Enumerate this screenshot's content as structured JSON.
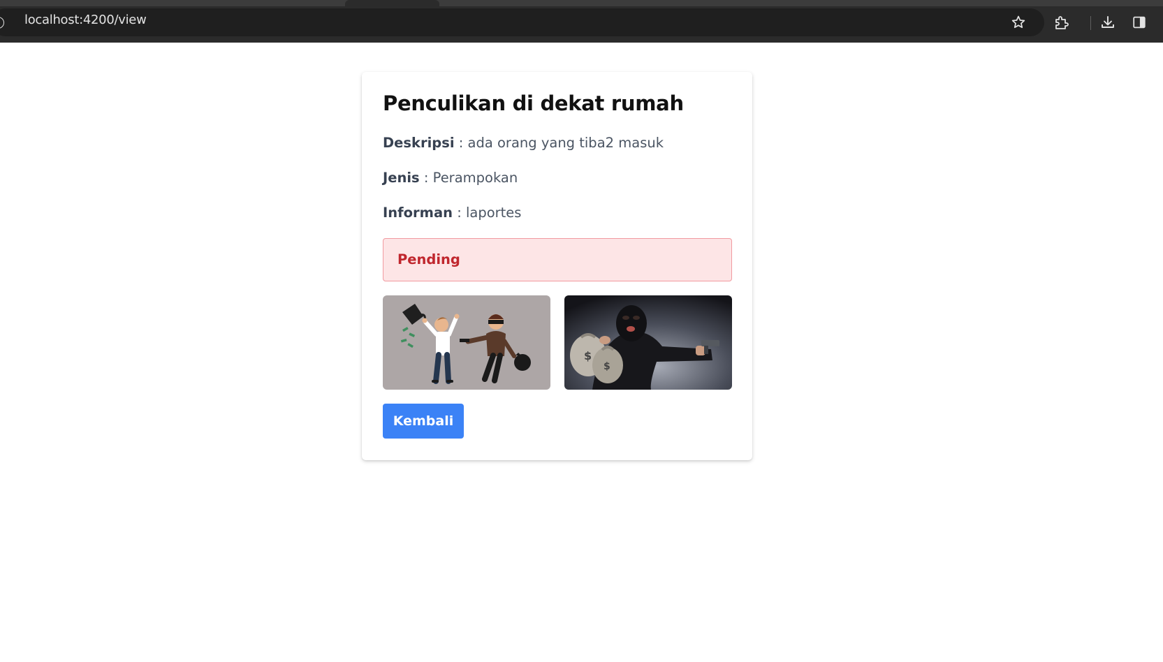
{
  "browser": {
    "url": "localhost:4200/view",
    "icons": [
      "info-icon",
      "star-icon",
      "extensions-icon",
      "download-icon",
      "side-panel-icon"
    ]
  },
  "report": {
    "title": "Penculikan di dekat rumah",
    "fields": [
      {
        "label": "Deskripsi",
        "separator": " : ",
        "value": "ada orang yang tiba2 masuk"
      },
      {
        "label": "Jenis",
        "separator": " : ",
        "value": "Perampokan"
      },
      {
        "label": "Informan",
        "separator": " : ",
        "value": "laportes"
      }
    ],
    "status": {
      "label": "Pending",
      "bg_color": "#fde5e6",
      "border_color": "#f19aa0",
      "text_color": "#c0262d"
    },
    "images": [
      {
        "name": "robbery-cartoon-image",
        "description": "cartoon robber with gun and money bag threatening man"
      },
      {
        "name": "masked-robber-photo",
        "description": "masked robber holding money bags and pistol"
      }
    ],
    "back_button": {
      "label": "Kembali",
      "color": "#3b82f6"
    }
  }
}
